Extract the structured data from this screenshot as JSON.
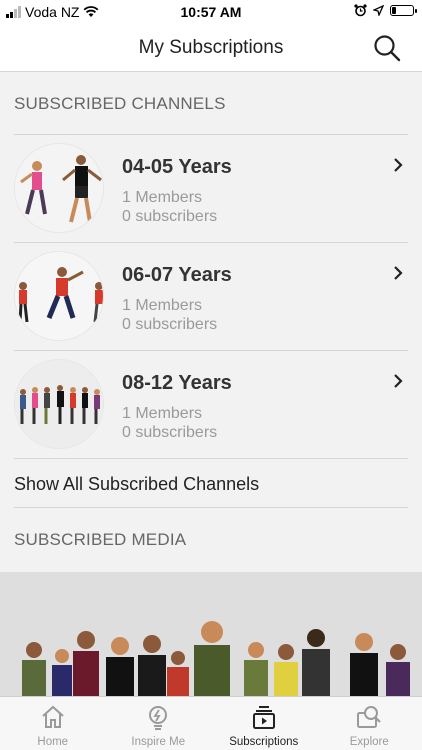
{
  "status_bar": {
    "carrier": "Voda NZ",
    "time": "10:57 AM",
    "battery_level": 0.2
  },
  "header": {
    "title": "My Subscriptions",
    "search_icon": "search-icon"
  },
  "sections": {
    "channels_header": "SUBSCRIBED CHANNELS",
    "media_header": "SUBSCRIBED MEDIA",
    "show_all": "Show All Subscribed Channels"
  },
  "channels": [
    {
      "name": "04-05 Years",
      "members": "1 Members",
      "subscribers": "0 subscribers"
    },
    {
      "name": "06-07 Years",
      "members": "1 Members",
      "subscribers": "0 subscribers"
    },
    {
      "name": "08-12 Years",
      "members": "1 Members",
      "subscribers": "0 subscribers"
    }
  ],
  "tabs": [
    {
      "label": "Home",
      "icon": "home-icon"
    },
    {
      "label": "Inspire Me",
      "icon": "lightbulb-icon"
    },
    {
      "label": "Subscriptions",
      "icon": "subscriptions-icon",
      "active": true
    },
    {
      "label": "Explore",
      "icon": "explore-icon"
    }
  ]
}
